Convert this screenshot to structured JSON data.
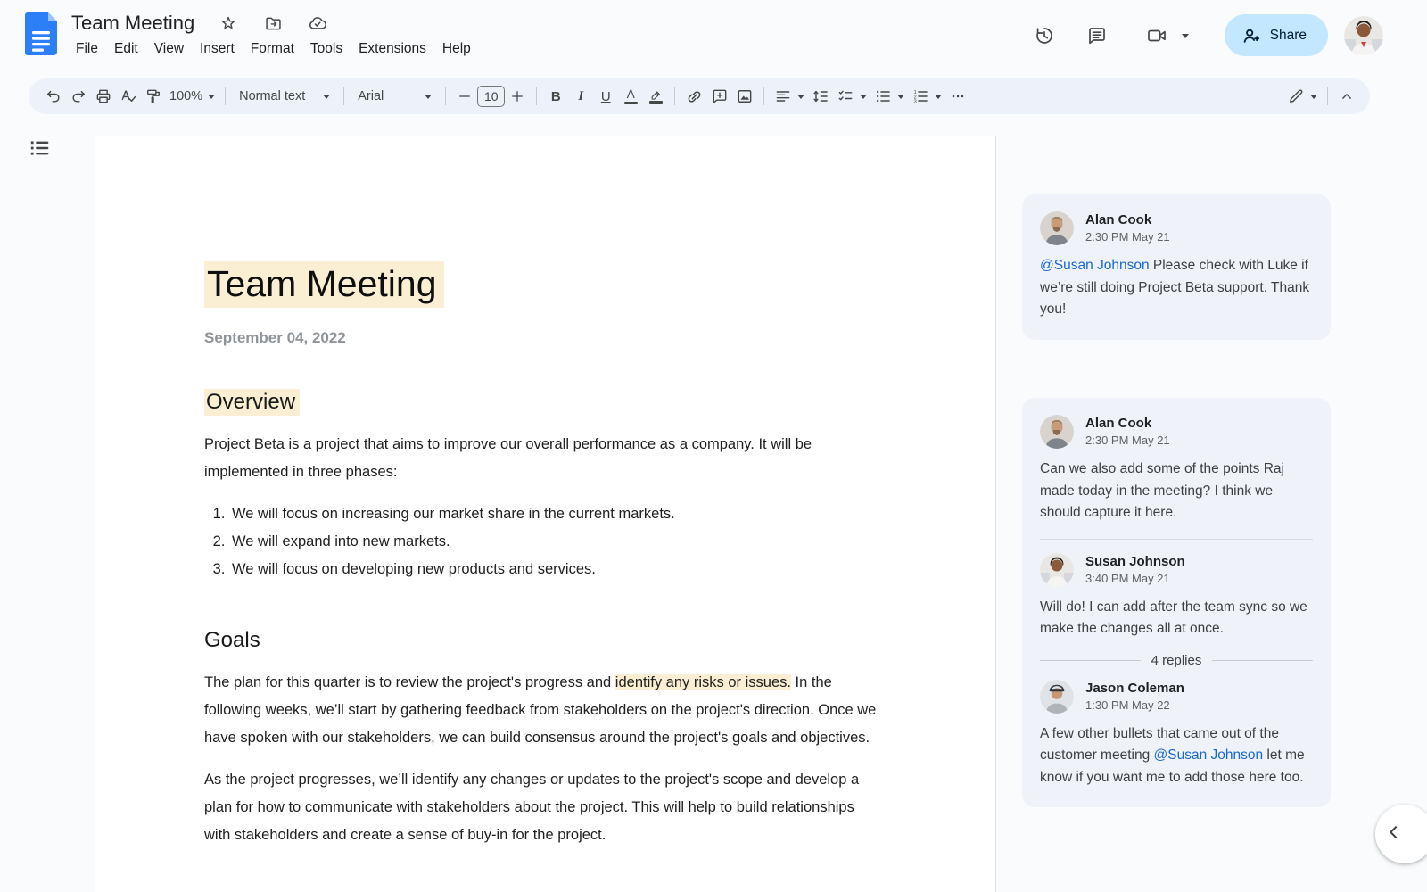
{
  "colors": {
    "share_button_bg": "#C2E7FF",
    "share_button_text": "#001D35",
    "text_highlight": "#FBEFD3",
    "mention_blue": "#1967D2",
    "docs_logo_blue": "#2D7FF9",
    "toolbar_bg": "#EDF2FA",
    "comment_card_bg": "#EFF3F9",
    "icon_gray": "#444746"
  },
  "icons": [
    "docs-logo",
    "star",
    "move-folder",
    "cloud-saved",
    "version-history",
    "comments",
    "video-call",
    "chevron-down",
    "person-add",
    "document-outline",
    "undo",
    "redo",
    "print",
    "spell-check",
    "paint-format",
    "bold",
    "italic",
    "underline",
    "text-color",
    "highlight-color",
    "insert-link",
    "add-comment",
    "insert-image",
    "align",
    "line-spacing",
    "checklist",
    "bulleted-list",
    "numbered-list",
    "more",
    "editing-mode-pen",
    "collapse-up",
    "chevron-left"
  ],
  "header": {
    "doc_title": "Team Meeting",
    "menu": [
      "File",
      "Edit",
      "View",
      "Insert",
      "Format",
      "Tools",
      "Extensions",
      "Help"
    ],
    "share_label": "Share"
  },
  "toolbar": {
    "zoom": "100%",
    "paragraph_style": "Normal text",
    "font": "Arial",
    "font_size": "10",
    "bold": "B",
    "italic": "I",
    "underline": "U",
    "text_color": "A"
  },
  "document": {
    "title": "Team Meeting",
    "date": "September 04, 2022",
    "overview": {
      "heading": "Overview",
      "para": "Project Beta is a project that aims to improve our overall performance as a company. It will be implemented in three phases:",
      "list": [
        "We will focus on increasing our market share in the current markets.",
        "We will expand into new markets.",
        "We will focus on developing new products and services."
      ]
    },
    "goals": {
      "heading": "Goals",
      "para1_pre": "The plan for this quarter is to review the project's progress and ",
      "para1_highlight": "identify any risks or issues.",
      "para1_post": " In the following weeks, we’ll start by gathering feedback from stakeholders on the project's direction. Once we have spoken with our stakeholders, we can build consensus around the project's goals and objectives.",
      "para2": "As the project progresses, we’ll identify any changes or updates to the project's scope and develop a plan for how to communicate with stakeholders about the project. This will help to build relationships with stakeholders and create a sense of buy-in for the project."
    }
  },
  "comments": {
    "card1": {
      "author": "Alan Cook",
      "time": "2:30 PM May 21",
      "mention": "@Susan Johnson",
      "text": " Please check with Luke if we’re still doing Project Beta support. Thank you!"
    },
    "card2": {
      "c1": {
        "author": "Alan Cook",
        "time": "2:30 PM May 21",
        "text": "Can we also add some of the points Raj made today in the meeting? I think we should capture it here."
      },
      "c2": {
        "author": "Susan Johnson",
        "time": "3:40 PM May 21",
        "text": "Will do! I can add after the team sync so we make the changes all at once."
      },
      "replies_label": "4 replies",
      "c3": {
        "author": "Jason Coleman",
        "time": "1:30 PM May 22",
        "pre": "A few other bullets that came out of the customer meeting ",
        "mention": "@Susan Johnson",
        "post": " let me know if you want me to add those here too."
      }
    }
  }
}
